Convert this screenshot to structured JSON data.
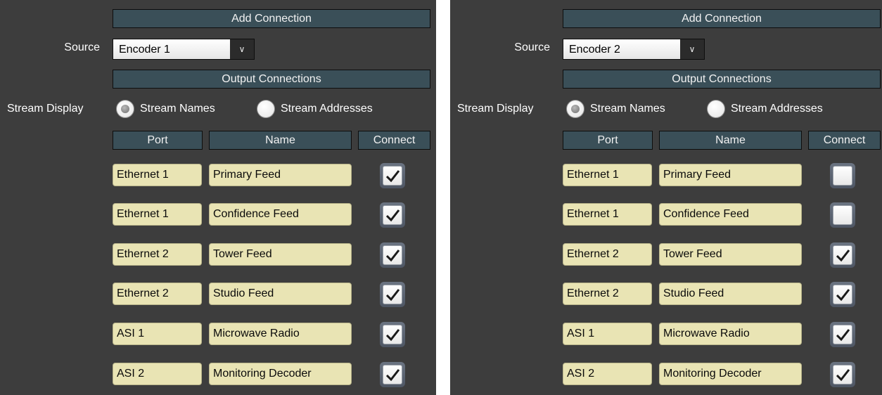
{
  "panels": [
    {
      "add_connection": "Add Connection",
      "source_label": "Source",
      "source_value": "Encoder 1",
      "output_connections": "Output Connections",
      "stream_display_label": "Stream Display",
      "radio_names": "Stream Names",
      "radio_addresses": "Stream Addresses",
      "radio_selected": "names",
      "col_port": "Port",
      "col_name": "Name",
      "col_connect": "Connect",
      "rows": [
        {
          "port": "Ethernet 1",
          "name": "Primary Feed",
          "connected": true
        },
        {
          "port": "Ethernet 1",
          "name": "Confidence Feed",
          "connected": true
        },
        {
          "port": "Ethernet 2",
          "name": "Tower Feed",
          "connected": true
        },
        {
          "port": "Ethernet 2",
          "name": "Studio Feed",
          "connected": true
        },
        {
          "port": "ASI 1",
          "name": "Microwave Radio",
          "connected": true
        },
        {
          "port": "ASI 2",
          "name": "Monitoring Decoder",
          "connected": true
        }
      ]
    },
    {
      "add_connection": "Add Connection",
      "source_label": "Source",
      "source_value": "Encoder 2",
      "output_connections": "Output Connections",
      "stream_display_label": "Stream Display",
      "radio_names": "Stream Names",
      "radio_addresses": "Stream Addresses",
      "radio_selected": "names",
      "col_port": "Port",
      "col_name": "Name",
      "col_connect": "Connect",
      "rows": [
        {
          "port": "Ethernet 1",
          "name": "Primary Feed",
          "connected": false
        },
        {
          "port": "Ethernet 1",
          "name": "Confidence Feed",
          "connected": false
        },
        {
          "port": "Ethernet 2",
          "name": "Tower Feed",
          "connected": true
        },
        {
          "port": "Ethernet 2",
          "name": "Studio Feed",
          "connected": true
        },
        {
          "port": "ASI 1",
          "name": "Microwave Radio",
          "connected": true
        },
        {
          "port": "ASI 2",
          "name": "Monitoring Decoder",
          "connected": true
        }
      ]
    }
  ]
}
